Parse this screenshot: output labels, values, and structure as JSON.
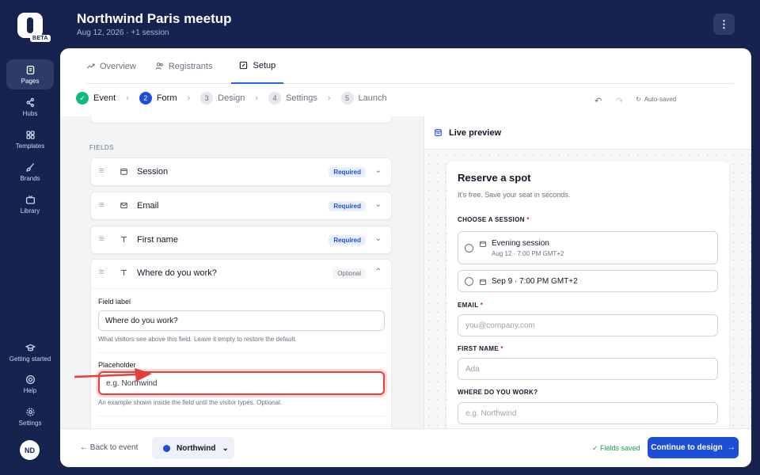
{
  "app": {
    "badge": "BETA"
  },
  "rail": {
    "items": [
      {
        "label": "Pages",
        "icon": "pages-icon"
      },
      {
        "label": "Hubs",
        "icon": "share-icon"
      },
      {
        "label": "Templates",
        "icon": "grid-icon"
      },
      {
        "label": "Brands",
        "icon": "brush-icon"
      },
      {
        "label": "Library",
        "icon": "tv-icon"
      }
    ],
    "bottom": [
      {
        "label": "Getting started",
        "icon": "graduation-cap-icon"
      },
      {
        "label": "Help",
        "icon": "lifebuoy-icon"
      },
      {
        "label": "Settings",
        "icon": "gear-icon"
      }
    ],
    "avatar": "ND"
  },
  "header": {
    "title": "Northwind Paris meetup",
    "subtitle": "Aug 12, 2026 · +1 session",
    "menu": "⋮"
  },
  "tabs": [
    {
      "label": "Overview",
      "icon": "trend-icon"
    },
    {
      "label": "Registrants",
      "icon": "users-icon"
    },
    {
      "label": "Setup",
      "icon": "edit-icon",
      "active": true
    }
  ],
  "steps": [
    {
      "num": "✓",
      "label": "Event",
      "state": "done"
    },
    {
      "num": "2",
      "label": "Form",
      "state": "current"
    },
    {
      "num": "3",
      "label": "Design",
      "state": "todo"
    },
    {
      "num": "4",
      "label": "Settings",
      "state": "todo"
    },
    {
      "num": "5",
      "label": "Launch",
      "state": "todo"
    }
  ],
  "toolbar": {
    "undo": "↶",
    "redo": "↷",
    "autosaved": "Auto-saved"
  },
  "fields": {
    "section_title": "FIELDS",
    "items": [
      {
        "name": "Session",
        "badge": "Required",
        "icon": "calendar-icon"
      },
      {
        "name": "Email",
        "badge": "Required",
        "icon": "mail-icon"
      },
      {
        "name": "First name",
        "badge": "Required",
        "icon": "text-icon"
      },
      {
        "name": "Where do you work?",
        "badge": "Optional",
        "icon": "text-icon"
      }
    ],
    "editor": {
      "label_title": "Field label",
      "label_value": "Where do you work?",
      "label_help": "What visitors see above this field. Leave it empty to restore the default.",
      "placeholder_title": "Placeholder",
      "placeholder_value": "e.g. Northwind",
      "placeholder_help": "An example shown inside the field until the visitor types. Optional."
    }
  },
  "preview": {
    "header": "Live preview",
    "title": "Reserve a spot",
    "subtitle": "It's free. Save your seat in seconds.",
    "session_label": "CHOOSE A SESSION",
    "sessions": [
      {
        "title": "Evening session",
        "detail": "Aug 12 · 7:00 PM GMT+2"
      },
      {
        "title": "Sep 9 · 7:00 PM GMT+2",
        "detail": ""
      }
    ],
    "email_label": "EMAIL",
    "email_placeholder": "you@company.com",
    "first_label": "FIRST NAME",
    "first_placeholder": "Ada",
    "work_label": "WHERE DO YOU WORK?",
    "work_placeholder": "e.g. Northwind",
    "required_mark": "*"
  },
  "footer": {
    "back": "← Back to event",
    "workspace": "Northwind",
    "workspace_chevron": "⌄",
    "saved": "✓ Fields saved",
    "continue": "Continue to design",
    "continue_arrow": "→"
  },
  "colors": {
    "brand": "#1d4ed8",
    "rail": "#16234f",
    "highlight": "#e53e3e",
    "success": "#16a34a"
  }
}
